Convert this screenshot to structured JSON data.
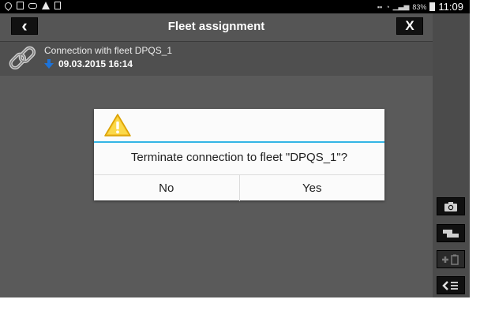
{
  "statusbar": {
    "left_icons": [
      "location-icon",
      "message-icon",
      "voicemail-icon",
      "warning-icon",
      "file-icon"
    ],
    "signal_label": "ᵢ⁴ₗ",
    "battery_percent": "83%",
    "time": "11:09"
  },
  "header": {
    "back_icon": "‹",
    "title": "Fleet assignment",
    "close_icon": "X"
  },
  "connection": {
    "title": "Connection with fleet DPQS_1",
    "datetime": "09.03.2015 16:14"
  },
  "dialog": {
    "message": "Terminate connection to fleet \"DPQS_1\"?",
    "no_label": "No",
    "yes_label": "Yes",
    "accent_color": "#33b5e5"
  },
  "side_buttons": [
    "camera-icon",
    "toggle-view-icon",
    "add-clipboard-icon",
    "collapse-menu-icon"
  ]
}
